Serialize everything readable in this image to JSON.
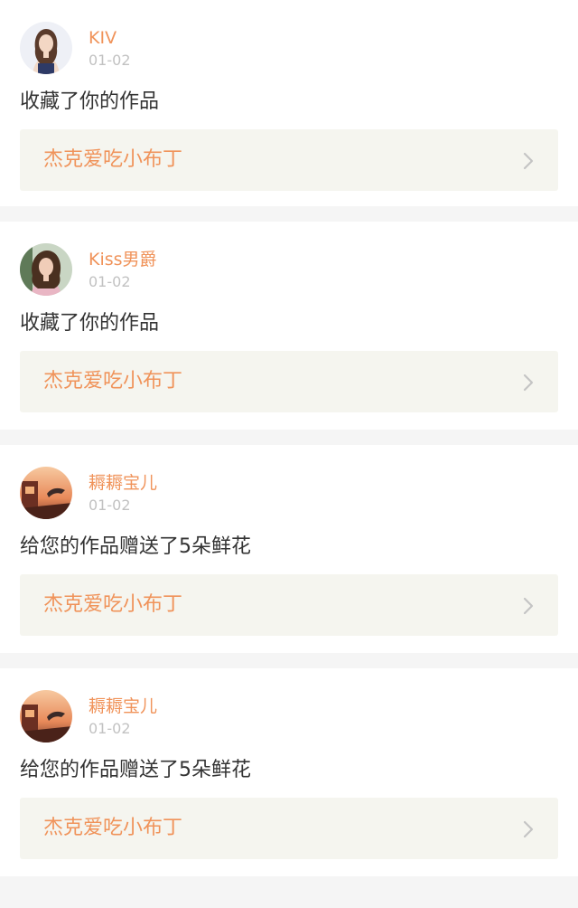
{
  "theme": {
    "accent": "#f0935a",
    "text": "#333333",
    "muted": "#c2c2c2",
    "link_bg": "#f5f5ef"
  },
  "notifications": [
    {
      "user_name": "KIV",
      "date": "01-02",
      "action_text": "收藏了你的作品",
      "work_title": "杰克爱吃小布丁",
      "avatar_icon": "woman-portrait-avatar"
    },
    {
      "user_name": "Kiss男爵",
      "date": "01-02",
      "action_text": "收藏了你的作品",
      "work_title": "杰克爱吃小布丁",
      "avatar_icon": "girl-portrait-avatar"
    },
    {
      "user_name": "耨耨宝儿",
      "date": "01-02",
      "action_text": "给您的作品赠送了5朵鲜花",
      "work_title": "杰克爱吃小布丁",
      "avatar_icon": "sunset-scene-avatar"
    },
    {
      "user_name": "耨耨宝儿",
      "date": "01-02",
      "action_text": "给您的作品赠送了5朵鲜花",
      "work_title": "杰克爱吃小布丁",
      "avatar_icon": "sunset-scene-avatar"
    }
  ]
}
